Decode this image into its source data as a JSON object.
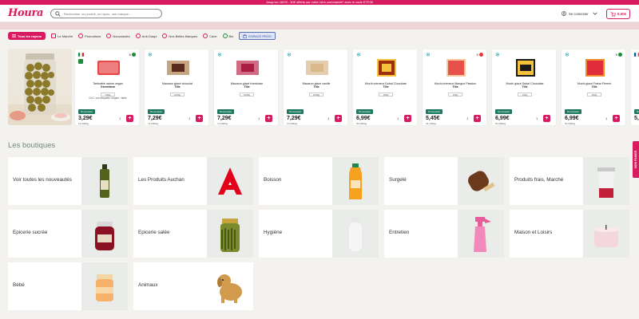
{
  "banner": {
    "text": "Jusqu'au 18/09 : 30€ offerts sur votre 1ère commande* avec le code ETE30"
  },
  "header": {
    "logo": "Houra",
    "search_placeholder": "Rechercher un produit, un rayon, une marque...",
    "account_label": "Se connecter",
    "cart_total": "0,00€"
  },
  "nav": {
    "all_label": "Tous les rayons",
    "items": [
      "Le Marché",
      "Promotions",
      "Nouveautés",
      "Anti-Gaspi",
      "Nos Belles Marques",
      "Cave",
      "Bio"
    ],
    "pros_label": "ESPACE PROS"
  },
  "products": [
    {
      "name": "Tartinable nature vegan",
      "brand": "Greenfarm",
      "qty": "150g",
      "note": "DLC: voir étiquette Origine : Italie",
      "badge": "Nouveauté",
      "price": "3,29€",
      "unit": "21,93€/kg",
      "nutri": "B",
      "flag": "it",
      "bio": true,
      "frozen": false
    },
    {
      "name": "Macaron glacé chocolat",
      "brand": "Tille",
      "qty": "2x50g",
      "note": "",
      "badge": "Nouveauté",
      "price": "7,29€",
      "unit": "72,90€/kg",
      "nutri": "",
      "flag": "",
      "bio": false,
      "frozen": true
    },
    {
      "name": "Macaron glacé framboise",
      "brand": "Tille",
      "qty": "2x50g",
      "note": "",
      "badge": "Nouveauté",
      "price": "7,29€",
      "unit": "72,90€/kg",
      "nutri": "",
      "flag": "",
      "bio": false,
      "frozen": true
    },
    {
      "name": "Macaron glacé vanille",
      "brand": "Tille",
      "qty": "2x50g",
      "note": "",
      "badge": "Nouveauté",
      "price": "7,29€",
      "unit": "72,90€/kg",
      "nutri": "",
      "flag": "",
      "bio": false,
      "frozen": true
    },
    {
      "name": "Mochi crémeux Dubaï Chocolate",
      "brand": "Tille",
      "qty": "150g",
      "note": "",
      "badge": "Nouveauté",
      "price": "6,99€",
      "unit": "50,00€/kg",
      "nutri": "",
      "flag": "",
      "bio": false,
      "frozen": true
    },
    {
      "name": "Mochi crémeux Mangue Passion",
      "brand": "Tille",
      "qty": "150g",
      "note": "",
      "badge": "Nouveauté",
      "price": "5,45€",
      "unit": "46,43€/kg",
      "nutri": "E",
      "flag": "",
      "bio": false,
      "frozen": true
    },
    {
      "name": "Mochi glacé Dubaï Chocolate",
      "brand": "Tille",
      "qty": "150g",
      "note": "",
      "badge": "Nouveauté",
      "price": "6,99€",
      "unit": "50,00€/kg",
      "nutri": "",
      "flag": "",
      "bio": false,
      "frozen": true
    },
    {
      "name": "Mochi glacé Fraise Piment",
      "brand": "Tille",
      "qty": "150g",
      "note": "",
      "badge": "Nouveauté",
      "price": "6,99€",
      "unit": "50,00€/kg",
      "nutri": "B",
      "flag": "",
      "bio": false,
      "frozen": true
    },
    {
      "name": "",
      "brand": "",
      "qty": "",
      "note": "",
      "badge": "Nouveauté",
      "price": "5,39",
      "unit": "",
      "nutri": "",
      "flag": "fr",
      "bio": false,
      "frozen": false
    }
  ],
  "product_default_qty": "1",
  "boutiques": {
    "title": "Les boutiques",
    "items": [
      {
        "label": "Voir toutes les nouveautés",
        "icon": "oil-bottle"
      },
      {
        "label": "Les Produits Auchan",
        "icon": "auchan-logo"
      },
      {
        "label": "Boisson",
        "icon": "juice-bottle"
      },
      {
        "label": "Surgelé",
        "icon": "ice-cream"
      },
      {
        "label": "Produits frais, Marché",
        "icon": "yogurt-jar"
      },
      {
        "label": "Epicerie sucrée",
        "icon": "jam-jar"
      },
      {
        "label": "Epicerie salée",
        "icon": "pickle-jar"
      },
      {
        "label": "Hygiène",
        "icon": "shampoo-bottle"
      },
      {
        "label": "Entretien",
        "icon": "spray-bottle"
      },
      {
        "label": "Maison et Loisirs",
        "icon": "candle"
      },
      {
        "label": "Bébé",
        "icon": "baby-food-jar"
      },
      {
        "label": "Animaux",
        "icon": "dog"
      }
    ]
  },
  "side_tab": "MON PANIER",
  "colors": {
    "brand": "#d81b60",
    "badge": "#1e7a5e",
    "title": "#6e8a7a"
  }
}
